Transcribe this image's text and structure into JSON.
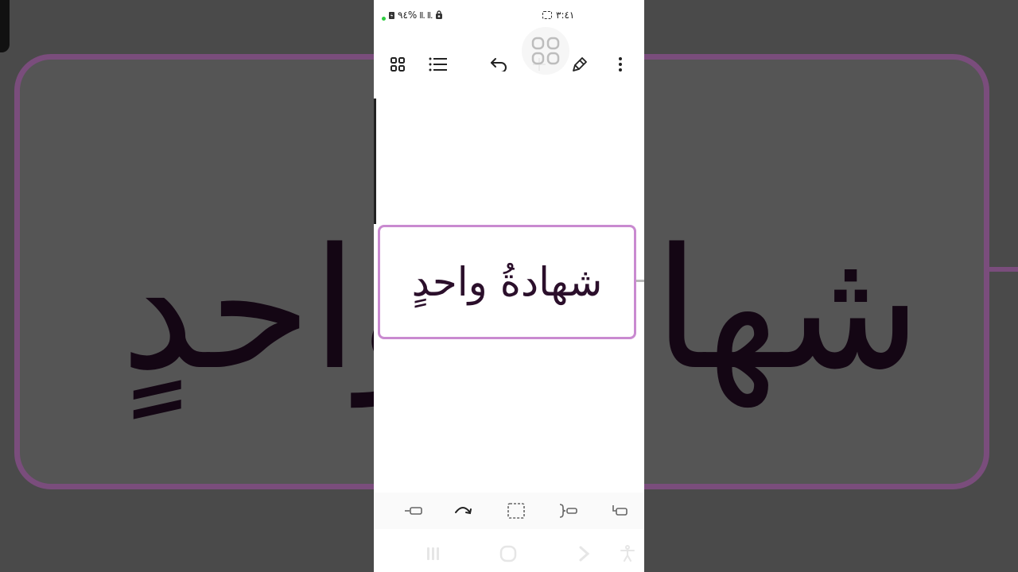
{
  "status_bar": {
    "battery": "%٩٤",
    "signal_1": "ll.",
    "signal_2": "ll.",
    "time": "٣:٤١"
  },
  "toolbar": {
    "icons": [
      "grid-view-icon",
      "list-view-icon",
      "undo-icon",
      "add-icon",
      "pen-icon",
      "more-icon"
    ]
  },
  "background_mirror_text": "شهادةُ واحدٍ",
  "mindmap": {
    "node_text": "شهادةُ واحدٍ",
    "node_border_color": "#c98ad0",
    "text_color": "#2b0f2b"
  },
  "bottom_tools": {
    "icons": [
      "add-sibling-icon",
      "redo-curve-icon",
      "select-box-icon",
      "bracket-node-icon",
      "add-child-icon"
    ]
  },
  "nav_bar": {
    "icons": [
      "recents-icon",
      "home-icon",
      "back-icon",
      "accessibility-icon"
    ]
  }
}
